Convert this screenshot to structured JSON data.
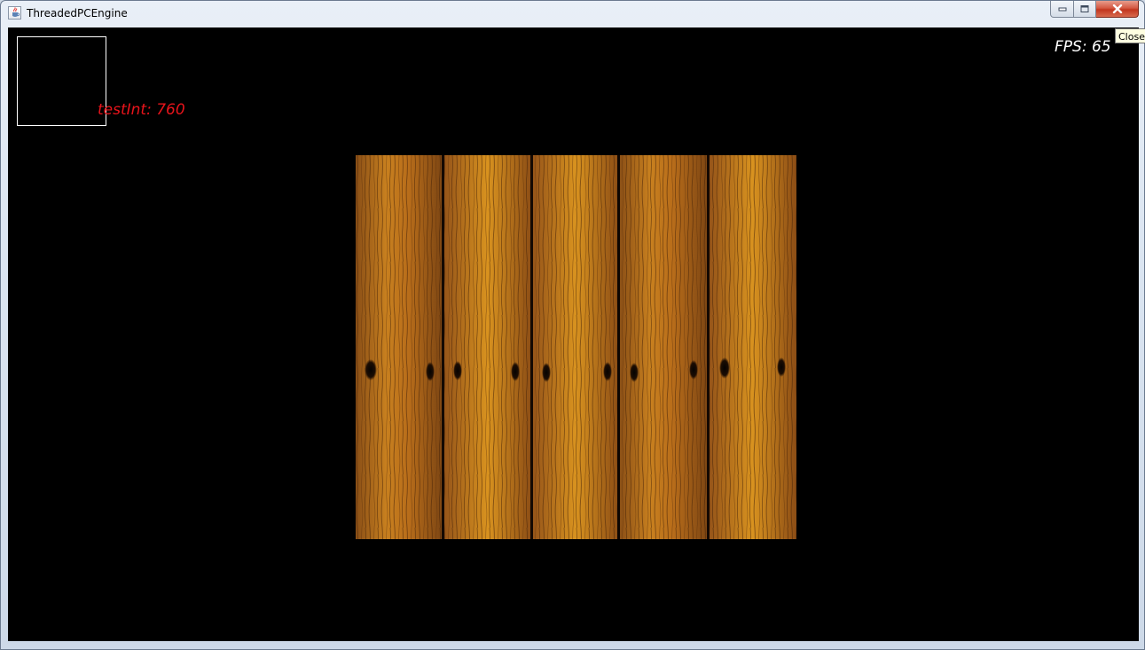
{
  "window": {
    "title": "ThreadedPCEngine",
    "tooltip": "Close",
    "icon": "java-coffee-icon",
    "caption_buttons": [
      "minimize-icon",
      "maximize-icon",
      "close-icon"
    ]
  },
  "canvas": {
    "background": "#000000",
    "test_int_text": "testInt: 760",
    "test_int_color": "#e8141b",
    "fps_text": "FPS: 65",
    "fps_color": "#ffffff",
    "texture": "wood-plank-texture",
    "plank_count": 5
  }
}
